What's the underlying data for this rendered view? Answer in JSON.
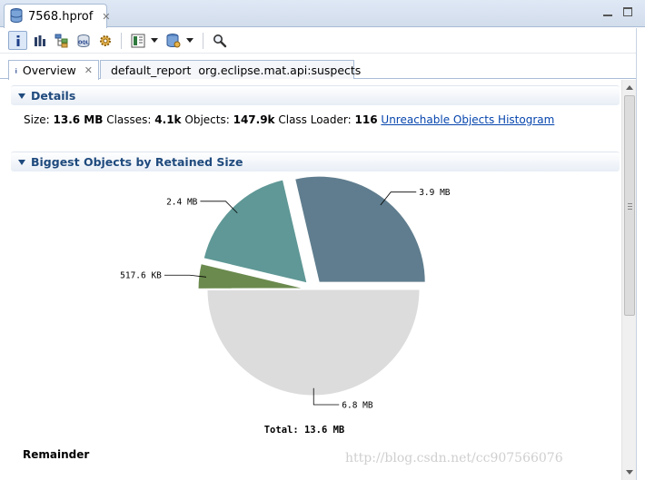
{
  "editor_tab": {
    "title": "7568.hprof",
    "close": "✕"
  },
  "toolbar": {
    "items": [
      {
        "icon": "info-icon",
        "active": true
      },
      {
        "icon": "histogram-icon"
      },
      {
        "icon": "dominator-tree-icon"
      },
      {
        "icon": "oql-icon"
      },
      {
        "icon": "thread-overview-icon"
      },
      {
        "icon": "query-browser-icon",
        "dropdown": true
      },
      {
        "icon": "heap-dump-query-icon",
        "dropdown": true
      },
      {
        "icon": "search-icon"
      }
    ]
  },
  "inner_tabs": {
    "overview": {
      "label": "Overview",
      "close": "✕"
    },
    "report": {
      "label": "default_report  org.eclipse.mat.api:suspects"
    }
  },
  "details": {
    "header": "Details",
    "size_label": "Size:",
    "size_value": "13.6 MB",
    "classes_label": "Classes:",
    "classes_value": "4.1k",
    "objects_label": "Objects:",
    "objects_value": "147.9k",
    "loader_label": "Class Loader:",
    "loader_value": "116",
    "link": "Unreachable Objects Histogram"
  },
  "biggest": {
    "header": "Biggest Objects by Retained Size",
    "remainder_label": "Remainder"
  },
  "chart_data": {
    "type": "pie",
    "total_label": "Total: 13.6 MB",
    "slices": [
      {
        "label": "3.9 MB",
        "value": 3.9,
        "color": "#5f7d8e",
        "exploded": true
      },
      {
        "label": "2.4 MB",
        "value": 2.4,
        "color": "#5f9896",
        "exploded": true
      },
      {
        "label": "517.6 KB",
        "value": 0.5176,
        "color": "#6b8a4e",
        "exploded": true
      },
      {
        "label": "6.8 MB",
        "value": 6.8,
        "color": "#dcdcdc",
        "exploded": false
      }
    ]
  },
  "watermark": "http://blog.csdn.net/cc907566076"
}
